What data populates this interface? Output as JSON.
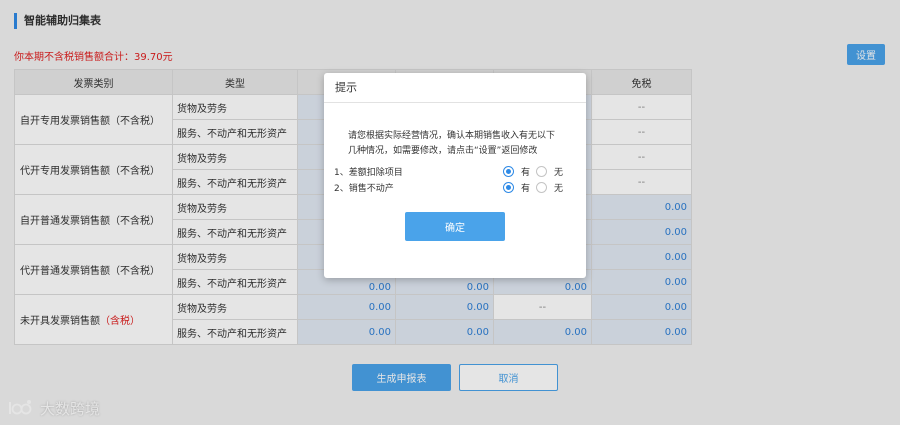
{
  "page": {
    "title": "智能辅助归集表",
    "summary_label": "你本期不含税销售额合计：",
    "summary_value": "39.70元",
    "settings_button": "设置"
  },
  "table": {
    "headers": [
      "发票类别",
      "类型",
      "",
      "",
      "",
      "免税"
    ],
    "rows": [
      {
        "category": "自开专用发票销售额（不含税）",
        "type": "货物及劳务",
        "c1": "",
        "c2": "",
        "c3": "",
        "exempt": "--"
      },
      {
        "category": "",
        "type": "服务、不动产和无形资产",
        "c1": "",
        "c2": "",
        "c3": "",
        "exempt": "--"
      },
      {
        "category": "代开专用发票销售额（不含税）",
        "type": "货物及劳务",
        "c1": "",
        "c2": "",
        "c3": "",
        "exempt": "--"
      },
      {
        "category": "",
        "type": "服务、不动产和无形资产",
        "c1": "",
        "c2": "",
        "c3": "",
        "exempt": "--"
      },
      {
        "category": "自开普通发票销售额（不含税）",
        "type": "货物及劳务",
        "c1": "",
        "c2": "",
        "c3": "",
        "exempt": "0.00"
      },
      {
        "category": "",
        "type": "服务、不动产和无形资产",
        "c1": "",
        "c2": "",
        "c3": "",
        "exempt": "0.00"
      },
      {
        "category": "代开普通发票销售额（不含税）",
        "type": "货物及劳务",
        "c1": "",
        "c2": "",
        "c3": "",
        "exempt": "0.00"
      },
      {
        "category": "",
        "type": "服务、不动产和无形资产",
        "c1": "0.00",
        "c2": "0.00",
        "c3": "0.00",
        "exempt": "0.00"
      },
      {
        "category": "未开具发票销售额",
        "category_suffix": "（含税）",
        "type": "货物及劳务",
        "c1": "0.00",
        "c2": "0.00",
        "c3": "--",
        "exempt": "0.00"
      },
      {
        "category": "",
        "type": "服务、不动产和无形资产",
        "c1": "0.00",
        "c2": "0.00",
        "c3": "0.00",
        "exempt": "0.00"
      }
    ]
  },
  "dialog": {
    "title": "提示",
    "message_line1": "请您根据实际经营情况，确认本期销售收入有无以下",
    "message_line2": "几种情况，如需要修改，请点击“设置”返回修改",
    "options": [
      {
        "label": "1、差额扣除项目",
        "yes": "有",
        "no": "无",
        "selected": "yes"
      },
      {
        "label": "2、销售不动产",
        "yes": "有",
        "no": "无",
        "selected": "yes"
      }
    ],
    "confirm_button": "确定"
  },
  "footer": {
    "generate_button": "生成申报表",
    "cancel_button": "取消"
  },
  "watermark": {
    "text": "大数跨境"
  },
  "colors": {
    "accent": "#4aa3ea",
    "warning_text": "#e02020",
    "value_text": "#2e7fd6"
  }
}
